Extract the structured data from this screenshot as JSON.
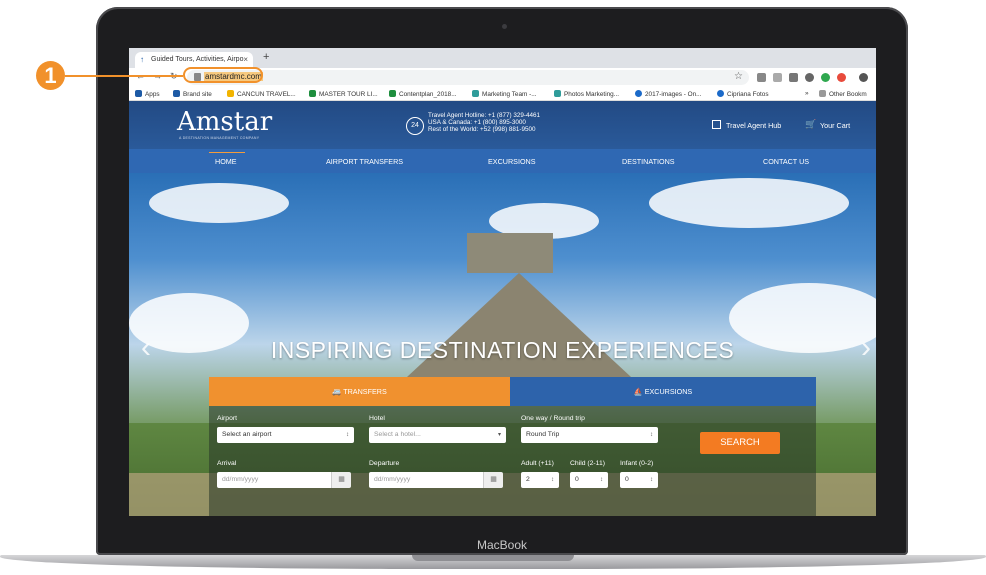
{
  "callout": {
    "number": "1"
  },
  "laptop": {
    "brand": "MacBook"
  },
  "browser": {
    "tab_title": "Guided Tours, Activities, Airpo",
    "tab_close": "×",
    "new_tab": "+",
    "url": "amstardmc.com",
    "bookmarks": [
      "Apps",
      "Brand site",
      "CANCUN TRAVEL...",
      "MASTER TOUR LI...",
      "Contentplan_2018...",
      "Marketing Team -...",
      "Photos Marketing...",
      "2017-images - On...",
      "Cipriana Fotos",
      "»",
      "Other Bookm"
    ]
  },
  "header": {
    "logo": "Amstar",
    "logo_sub": "A DESTINATION MANAGEMENT COMPANY",
    "hotline_icon": "24",
    "hotline_lines": [
      "Travel Agent Hotline: +1 (877) 329-4461",
      "USA & Canada: +1 (800) 895-3000",
      "Rest of the World: +52 (998) 881-9500"
    ],
    "travel_agent_hub": "Travel Agent Hub",
    "your_cart": "Your Cart"
  },
  "nav": {
    "items": [
      "HOME",
      "AIRPORT TRANSFERS",
      "EXCURSIONS",
      "DESTINATIONS",
      "CONTACT US"
    ],
    "active": "HOME"
  },
  "hero": {
    "title": "INSPIRING DESTINATION EXPERIENCES"
  },
  "widget": {
    "tabs": [
      "TRANSFERS",
      "EXCURSIONS"
    ],
    "active_tab": "TRANSFERS",
    "airport_label": "Airport",
    "airport_value": "Select an airport",
    "hotel_label": "Hotel",
    "hotel_placeholder": "Select a hotel...",
    "trip_label": "One way / Round trip",
    "trip_value": "Round Trip",
    "search_label": "SEARCH",
    "arrival_label": "Arrival",
    "arrival_placeholder": "dd/mm/yyyy",
    "departure_label": "Departure",
    "departure_placeholder": "dd/mm/yyyy",
    "adult_label": "Adult (+11)",
    "adult_value": "2",
    "child_label": "Child (2-11)",
    "child_value": "0",
    "infant_label": "Infant (0-2)",
    "infant_value": "0"
  },
  "colors": {
    "header": "#224a84",
    "nav": "#2f68b3",
    "transfers_tab": "#f0912f",
    "excursions_tab": "#2d63ab",
    "search": "#f37b22",
    "callout": "#f1912b"
  }
}
